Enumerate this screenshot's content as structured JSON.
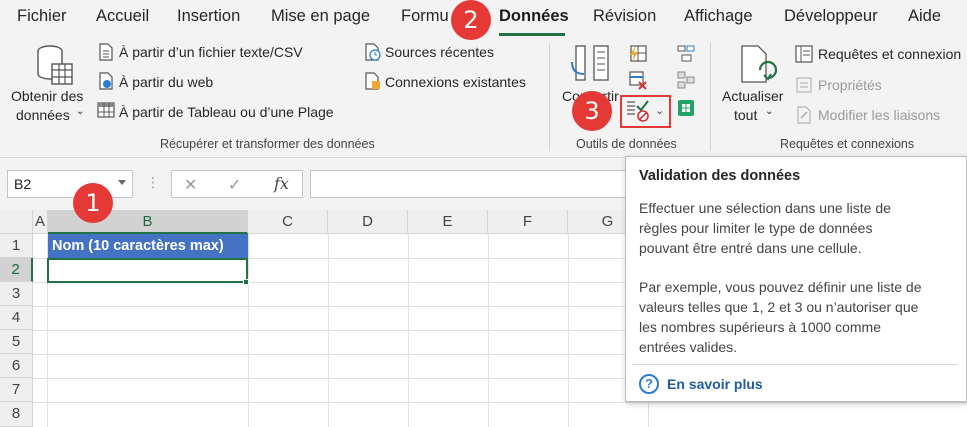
{
  "tabs": [
    "Fichier",
    "Accueil",
    "Insertion",
    "Mise en page",
    "Formu",
    "Données",
    "Révision",
    "Affichage",
    "Développeur",
    "Aide"
  ],
  "ribbon": {
    "get_data": {
      "line1": "Obtenir des",
      "line2": "données"
    },
    "from_text_csv": "À partir d’un fichier texte/CSV",
    "from_web": "À partir du web",
    "from_table": "À partir de Tableau ou d’une Plage",
    "recent_sources": "Sources récentes",
    "existing_connections": "Connexions existantes",
    "group_get_transform": "Récupérer et transformer des données",
    "convert_partial": "Convertir",
    "group_data_tools": "Outils de données",
    "refresh_all": {
      "line1": "Actualiser",
      "line2": "tout"
    },
    "queries_connections": "Requêtes et connexion",
    "properties": "Propriétés",
    "edit_links": "Modifier les liaisons",
    "group_queries": "Requêtes et connexions"
  },
  "formula_bar": {
    "name_box": "B2",
    "cancel_symbol": "✕",
    "enter_symbol": "✓",
    "fx_symbol": "fx",
    "value": ""
  },
  "grid": {
    "columns": [
      "A",
      "B",
      "C",
      "D",
      "E",
      "F",
      "G"
    ],
    "rows": [
      "1",
      "2",
      "3",
      "4",
      "5",
      "6",
      "7",
      "8"
    ],
    "b1_value": "Nom (10 caractères max)",
    "selected_cell": "B2"
  },
  "tooltip": {
    "title": "Validation des données",
    "paragraph1": [
      "Effectuer une sélection dans une liste de",
      "règles pour limiter le type de données",
      "pouvant être entré dans une cellule."
    ],
    "paragraph2": [
      "Par exemple, vous pouvez définir une liste de",
      "valeurs telles que 1, 2 et 3 ou n’autoriser que",
      "les nombres supérieurs à 1000 comme",
      "entrées valides."
    ],
    "help_symbol": "?",
    "learn_more": "En savoir plus"
  },
  "callouts": [
    "1",
    "2",
    "3"
  ],
  "colors": {
    "accent_green": "#217346",
    "header_blue": "#4472c4",
    "callout_red": "#e53935",
    "link_blue": "#1f5aa6"
  }
}
